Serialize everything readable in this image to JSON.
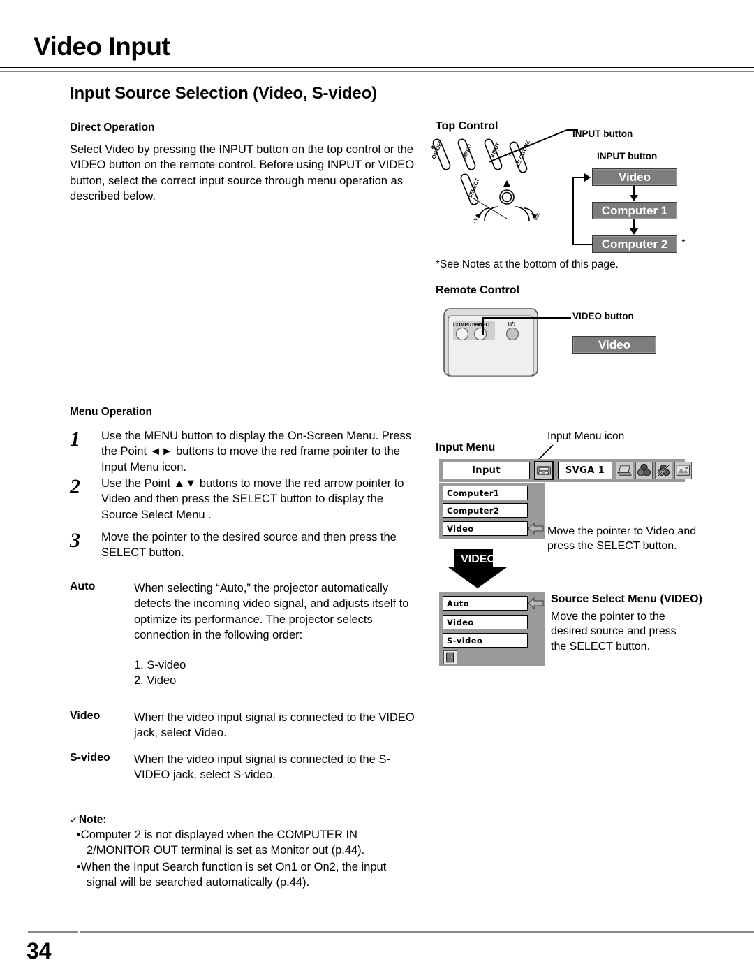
{
  "header": {
    "title": "Video Input"
  },
  "section": {
    "title": "Input Source Selection (Video, S-video)"
  },
  "direct_operation": {
    "heading": "Direct Operation",
    "body": "Select Video by pressing the INPUT button on the top control or the VIDEO button on the remote control. Before using  INPUT or VIDEO button, select the correct input source through menu operation as described below."
  },
  "menu_operation": {
    "heading": "Menu Operation",
    "steps": [
      {
        "num": "1",
        "text": "Use the MENU button to display the On-Screen Menu. Press the Point ◄► buttons to move the red frame pointer to the Input Menu icon."
      },
      {
        "num": "2",
        "text": "Use the Point ▲▼ buttons to move the red arrow pointer to Video and then press the SELECT button to display the Source Select Menu ."
      },
      {
        "num": "3",
        "text": "Move the pointer to the desired source and then press the SELECT button."
      }
    ],
    "definitions": [
      {
        "term": "Auto",
        "body": "When selecting “Auto,” the projector automatically detects the incoming video signal, and adjusts itself to optimize its performance. The projector selects connection in the following order:",
        "list": [
          "1. S-video",
          "2. Video"
        ]
      },
      {
        "term": "Video",
        "body": "When the video input signal is connected to the VIDEO jack, select Video.",
        "list": []
      },
      {
        "term": "S-video",
        "body": "When the video input signal is connected to the S-VIDEO jack, select S-video.",
        "list": []
      }
    ]
  },
  "note": {
    "check": "✓",
    "heading": "Note:",
    "items": [
      "•Computer 2 is not displayed when the COMPUTER IN 2/MONITOR OUT terminal is set as Monitor out (p.44).",
      "•When the Input Search function is set On1 or On2, the input signal will be searched automatically (p.44)."
    ]
  },
  "top_control": {
    "heading": "Top Control",
    "callout_input_button": "INPUT button",
    "flow_label": "INPUT button",
    "flow_boxes": [
      "Video",
      "Computer 1",
      "Computer 2"
    ],
    "asterisk": "*",
    "footnote": "*See Notes at the bottom of this page.",
    "button_labels": [
      "ON-OFF",
      "MENU",
      "INPUT",
      "KEYSTONE",
      "SELECT",
      "VOL."
    ]
  },
  "remote_control": {
    "heading": "Remote Control",
    "callout_video_button": "VIDEO button",
    "flow_box": "Video",
    "buttons": [
      "COMPUTER",
      "VIDEO",
      "I/⏻"
    ]
  },
  "input_menu": {
    "heading": "Input Menu",
    "icon_callout": "Input Menu icon",
    "title_field": "Input",
    "mode_field": "SVGA  1",
    "items": [
      "Computer1",
      "Computer2",
      "Video"
    ],
    "instruction": "Move the pointer to Video and press the SELECT button.",
    "icon_names": [
      "input-menu-icon",
      "computer-adjust-icon",
      "color-adjust-icon",
      "screen-adjust-icon",
      "setting-icon"
    ]
  },
  "source_select": {
    "arrow_label": "VIDEO",
    "heading": "Source Select Menu (VIDEO)",
    "items": [
      "Auto",
      "Video",
      "S-video"
    ],
    "instruction": "Move the pointer to the desired source and press the SELECT button.",
    "quit_icon": "quit-icon"
  },
  "footer": {
    "page_number": "34"
  },
  "colors": {
    "gray_box": "#7d7d7d",
    "osd_panel": "#9a9a9a",
    "ink": "#000000"
  }
}
